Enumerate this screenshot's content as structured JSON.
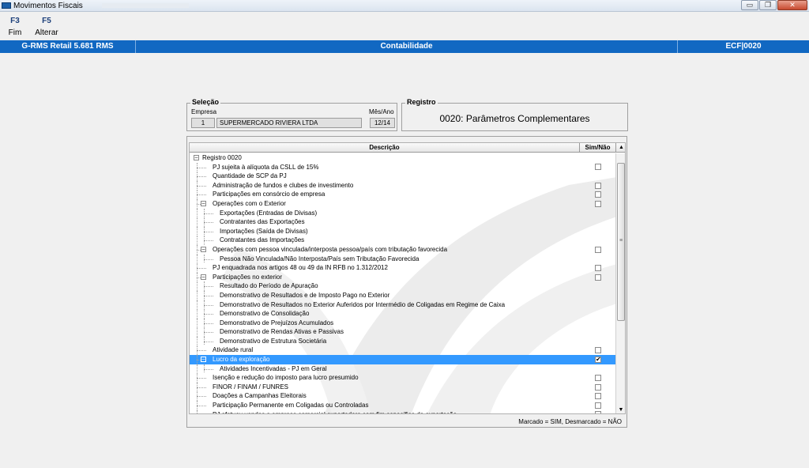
{
  "window": {
    "title": "Movimentos Fiscais",
    "controls": {
      "minimize": "▭",
      "restore": "❐",
      "close": "✕"
    }
  },
  "toolbar": [
    {
      "key": "F3",
      "label": "Fim"
    },
    {
      "key": "F5",
      "label": "Alterar"
    }
  ],
  "header": {
    "left": "G-RMS Retail 5.681 RMS",
    "center": "Contabilidade",
    "right": "ECF|0020"
  },
  "selecao": {
    "title": "Seleção",
    "empresa_label": "Empresa",
    "empresa_code": "1",
    "empresa_name": "SUPERMERCADO RIVIERA LTDA",
    "mesano_label": "Mês/Ano",
    "mesano_value": "12/14"
  },
  "registro": {
    "title": "Registro",
    "value": "0020: Parâmetros Complementares"
  },
  "grid": {
    "col_descricao": "Descrição",
    "col_simnao": "Sim/Não",
    "rows": [
      {
        "text": "Registro 0020",
        "level": 0,
        "expander": "−",
        "checkbox": false,
        "checked": false
      },
      {
        "text": "PJ sujeita à alíquota da CSLL de 15%",
        "level": 1,
        "expander": "",
        "checkbox": true,
        "checked": false
      },
      {
        "text": "Quantidade de SCP da PJ",
        "level": 1,
        "expander": "",
        "checkbox": false,
        "checked": false
      },
      {
        "text": "Administração de fundos e clubes de investimento",
        "level": 1,
        "expander": "",
        "checkbox": true,
        "checked": false
      },
      {
        "text": "Participações em consórcio de empresa",
        "level": 1,
        "expander": "",
        "checkbox": true,
        "checked": false
      },
      {
        "text": "Operações com o Exterior",
        "level": 1,
        "expander": "−",
        "checkbox": true,
        "checked": false
      },
      {
        "text": "Exportações (Entradas de Divisas)",
        "level": 2,
        "expander": "",
        "checkbox": false,
        "checked": false
      },
      {
        "text": "Contratantes das Exportações",
        "level": 2,
        "expander": "",
        "checkbox": false,
        "checked": false
      },
      {
        "text": "Importações (Saída de Divisas)",
        "level": 2,
        "expander": "",
        "checkbox": false,
        "checked": false
      },
      {
        "text": "Contratantes das Importações",
        "level": 2,
        "expander": "",
        "checkbox": false,
        "checked": false
      },
      {
        "text": "Operações com pessoa vinculada/interposta pessoa/país com tributação favorecida",
        "level": 1,
        "expander": "−",
        "checkbox": true,
        "checked": false
      },
      {
        "text": "Pessoa Não Vinculada/Não Interposta/País sem Tributação Favorecida",
        "level": 2,
        "expander": "",
        "checkbox": false,
        "checked": false
      },
      {
        "text": "PJ enquadrada nos artigos 48 ou 49 da IN RFB no 1.312/2012",
        "level": 1,
        "expander": "",
        "checkbox": true,
        "checked": false
      },
      {
        "text": "Participações no exterior",
        "level": 1,
        "expander": "−",
        "checkbox": true,
        "checked": false
      },
      {
        "text": "Resultado do Período de Apuração",
        "level": 2,
        "expander": "",
        "checkbox": false,
        "checked": false
      },
      {
        "text": "Demonstrativo de Resultados e de Imposto Pago no Exterior",
        "level": 2,
        "expander": "",
        "checkbox": false,
        "checked": false
      },
      {
        "text": "Demonstrativo de Resultados no Exterior Auferidos por Intermédio de Coligadas em Regime de Caixa",
        "level": 2,
        "expander": "",
        "checkbox": false,
        "checked": false
      },
      {
        "text": "Demonstrativo de Consolidação",
        "level": 2,
        "expander": "",
        "checkbox": false,
        "checked": false
      },
      {
        "text": "Demonstrativo de Prejuízos Acumulados",
        "level": 2,
        "expander": "",
        "checkbox": false,
        "checked": false
      },
      {
        "text": "Demonstrativo de Rendas Ativas e Passivas",
        "level": 2,
        "expander": "",
        "checkbox": false,
        "checked": false
      },
      {
        "text": "Demonstrativo de Estrutura Societária",
        "level": 2,
        "expander": "",
        "checkbox": false,
        "checked": false
      },
      {
        "text": "Atividade rural",
        "level": 1,
        "expander": "",
        "checkbox": true,
        "checked": false
      },
      {
        "text": "Lucro da exploração",
        "level": 1,
        "expander": "−",
        "checkbox": true,
        "checked": true,
        "selected": true
      },
      {
        "text": "Atividades Incentivadas - PJ em Geral",
        "level": 2,
        "expander": "",
        "checkbox": false,
        "checked": false
      },
      {
        "text": "Isenção e redução do imposto para lucro presumido",
        "level": 1,
        "expander": "",
        "checkbox": true,
        "checked": false
      },
      {
        "text": "FINOR / FINAM / FUNRES",
        "level": 1,
        "expander": "",
        "checkbox": true,
        "checked": false
      },
      {
        "text": "Doações a Campanhas Eleitorais",
        "level": 1,
        "expander": "",
        "checkbox": true,
        "checked": false
      },
      {
        "text": "Participação Permanente em Coligadas ou Controladas",
        "level": 1,
        "expander": "",
        "checkbox": true,
        "checked": false
      },
      {
        "text": "PJ efetuou vendas a empresa comercial exportadora com fim específico de exportação",
        "level": 1,
        "expander": "",
        "checkbox": true,
        "checked": false
      }
    ],
    "scroll_up": "▲",
    "scroll_down": "▼",
    "scroll_grip": "≡"
  },
  "footer_note": "Marcado = SIM, Desmarcado = NÃO"
}
